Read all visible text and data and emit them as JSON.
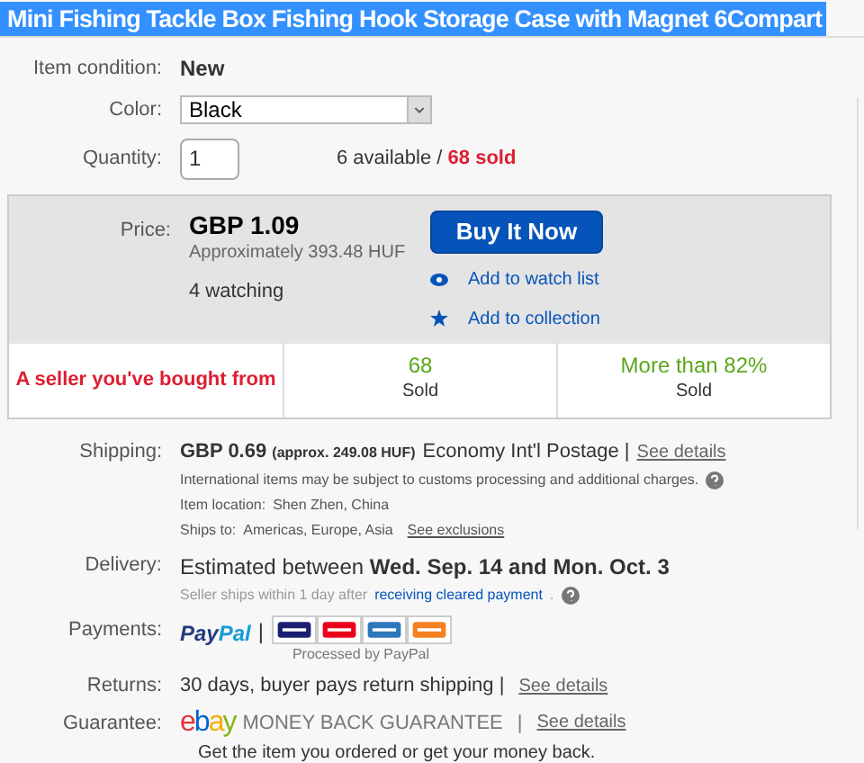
{
  "title": "Mini Fishing Tackle Box Fishing Hook Storage Case with Magnet 6Compart",
  "condition": {
    "label": "Item condition:",
    "value": "New"
  },
  "color": {
    "label": "Color:",
    "value": "Black"
  },
  "quantity": {
    "label": "Quantity:",
    "value": "1",
    "available": "6 available /",
    "sold": "68 sold"
  },
  "price": {
    "label": "Price:",
    "value": "GBP 1.09",
    "approx": "Approximately 393.48 HUF",
    "watching": "4 watching",
    "buy": "Buy It Now",
    "actions": [
      {
        "kind": "watch",
        "label": "Add to watch list"
      },
      {
        "kind": "collection",
        "label": "Add to collection"
      }
    ]
  },
  "seller_bar": {
    "note": "A seller you've bought from",
    "stats": [
      {
        "value": "68",
        "label": "Sold"
      },
      {
        "value": "More than 82%",
        "label": "Sold"
      }
    ]
  },
  "shipping": {
    "label": "Shipping:",
    "price": "GBP 0.69",
    "approx": "(approx. 249.08 HUF)",
    "service": "Economy Int'l Postage |",
    "link": "See details",
    "note": "International items may be subject to customs processing and additional charges.",
    "location_label": "Item location:",
    "location": "Shen Zhen, China",
    "ships_label": "Ships to:",
    "ships": "Americas, Europe, Asia",
    "exclusions": "See exclusions"
  },
  "delivery": {
    "label": "Delivery:",
    "text": "Estimated between **Wed. Sep. 14 and Mon. Oct. 3**",
    "note": "Seller ships within 1 day after",
    "link": "receiving cleared payment",
    "end": "."
  },
  "payments": {
    "label": "Payments:",
    "paypal": [
      "Pay",
      "Pal"
    ],
    "separator": "|",
    "processed": "Processed by PayPal"
  },
  "returns": {
    "label": "Returns:",
    "text": "30 days, buyer pays return shipping |",
    "link": "See details"
  },
  "guarantee": {
    "label": "Guarantee:",
    "logo": "ebay",
    "text": "MONEY BACK GUARANTEE",
    "separator": "|",
    "link": "See details",
    "note": "Get the item you ordered or get your money back."
  }
}
